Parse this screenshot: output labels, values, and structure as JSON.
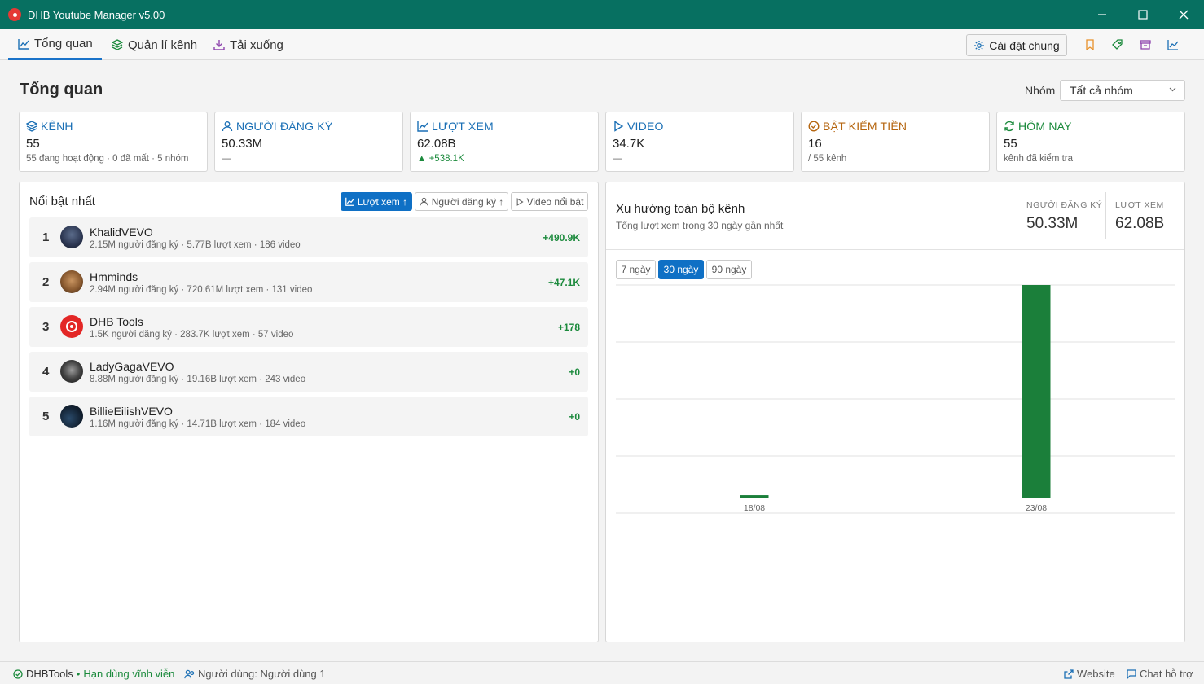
{
  "window": {
    "title": "DHB Youtube Manager v5.00"
  },
  "tabs": [
    {
      "label": "Tổng quan",
      "icon": "chart-icon",
      "active": true
    },
    {
      "label": "Quản lí kênh",
      "icon": "layers-icon",
      "active": false
    },
    {
      "label": "Tải xuống",
      "icon": "download-icon",
      "active": false
    }
  ],
  "toolbar": {
    "settings_label": "Cài đặt chung"
  },
  "page": {
    "title": "Tổng quan",
    "group_label": "Nhóm",
    "group_value": "Tất cả nhóm"
  },
  "stats": [
    {
      "label": "KÊNH",
      "value": "55",
      "sub": "55 đang hoạt động · 0 đã mất · 5 nhóm",
      "icon": "layers-icon",
      "color": "#1a6fb5"
    },
    {
      "label": "NGƯỜI ĐĂNG KÝ",
      "value": "50.33M",
      "sub": "—",
      "icon": "user-icon",
      "color": "#1a6fb5"
    },
    {
      "label": "LƯỢT XEM",
      "value": "62.08B",
      "sub": "▲ +538.1K",
      "icon": "chart-icon",
      "color": "#1a6fb5",
      "sub_color": "#1b8a3c"
    },
    {
      "label": "VIDEO",
      "value": "34.7K",
      "sub": "—",
      "icon": "play-icon",
      "color": "#1a6fb5"
    },
    {
      "label": "BẬT KIẾM TIỀN",
      "value": "16",
      "sub": "/ 55 kênh",
      "icon": "check-circle-icon",
      "color": "#b5650f"
    },
    {
      "label": "HÔM NAY",
      "value": "55",
      "sub": "kênh đã kiểm tra",
      "icon": "refresh-icon",
      "color": "#1b8a3c"
    }
  ],
  "featured": {
    "title": "Nổi bật nhất",
    "sort_buttons": [
      {
        "label": "Lượt xem ↑",
        "active": true
      },
      {
        "label": "Người đăng ký ↑",
        "active": false
      },
      {
        "label": "Video nổi bật",
        "active": false
      }
    ],
    "channels": [
      {
        "rank": "1",
        "name": "KhalidVEVO",
        "meta": "2.15M người đăng ký · 5.77B lượt xem · 186 video",
        "delta": "+490.9K"
      },
      {
        "rank": "2",
        "name": "Hmminds",
        "meta": "2.94M người đăng ký · 720.61M lượt xem · 131 video",
        "delta": "+47.1K"
      },
      {
        "rank": "3",
        "name": "DHB Tools",
        "meta": "1.5K người đăng ký · 283.7K lượt xem · 57 video",
        "delta": "+178"
      },
      {
        "rank": "4",
        "name": "LadyGagaVEVO",
        "meta": "8.88M người đăng ký · 19.16B lượt xem · 243 video",
        "delta": "+0"
      },
      {
        "rank": "5",
        "name": "BillieEilishVEVO",
        "meta": "1.16M người đăng ký · 14.71B lượt xem · 184 video",
        "delta": "+0"
      }
    ]
  },
  "trend": {
    "title": "Xu hướng toàn bộ kênh",
    "subtitle": "Tổng lượt xem trong 30 ngày gần nhất",
    "subs_label": "NGƯỜI ĐĂNG KÝ",
    "subs_value": "50.33M",
    "views_label": "LƯỢT XEM",
    "views_value": "62.08B",
    "ranges": [
      {
        "label": "7 ngày",
        "active": false
      },
      {
        "label": "30 ngày",
        "active": true
      },
      {
        "label": "90 ngày",
        "active": false
      }
    ]
  },
  "chart_data": {
    "type": "bar",
    "categories": [
      "18/08",
      "23/08"
    ],
    "values": [
      1.5,
      100
    ],
    "ylim": [
      0,
      100
    ],
    "grid": true,
    "color": "#1b7f3a"
  },
  "status": {
    "brand": "DHBTools",
    "license": "Hạn dùng vĩnh viễn",
    "user": "Người dùng: Người dùng 1",
    "website": "Website",
    "support": "Chat hỗ trợ"
  }
}
